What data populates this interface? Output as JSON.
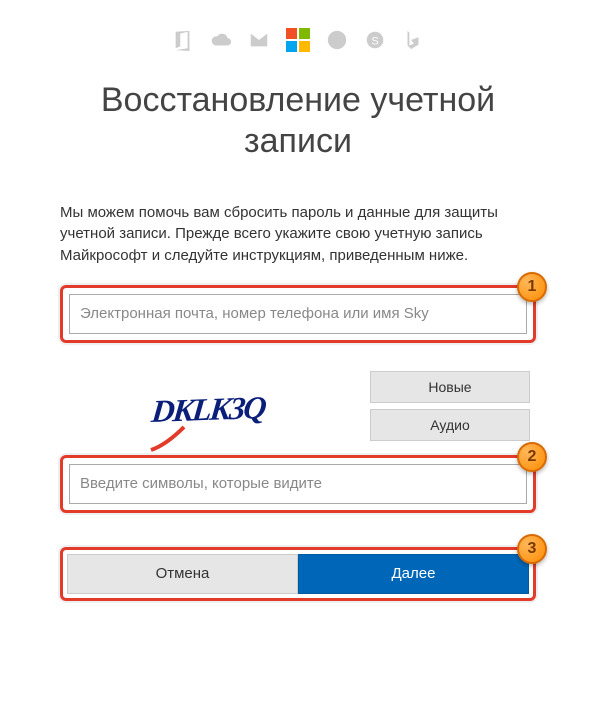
{
  "icons": {
    "office": "office-icon",
    "onedrive": "onedrive-icon",
    "outlook": "outlook-icon",
    "microsoft": "microsoft-logo",
    "xbox": "xbox-icon",
    "skype": "skype-icon",
    "bing": "bing-icon"
  },
  "title": "Восстановление учетной записи",
  "description": "Мы можем помочь вам сбросить пароль и данные для защиты учетной записи. Прежде всего укажите свою учетную запись Майкрософт и следуйте инструкциям, приведенным ниже.",
  "account_input": {
    "value": "",
    "placeholder": "Электронная почта, номер телефона или имя Sky"
  },
  "captcha": {
    "text": "DKLK3Q",
    "new_label": "Новые",
    "audio_label": "Аудио",
    "input_value": "",
    "input_placeholder": "Введите символы, которые видите"
  },
  "actions": {
    "cancel": "Отмена",
    "next": "Далее"
  },
  "annotations": {
    "step1": "1",
    "step2": "2",
    "step3": "3"
  },
  "colors": {
    "primary": "#0067b8",
    "highlight_border": "#e23b2a",
    "badge": "#ff8c00"
  }
}
